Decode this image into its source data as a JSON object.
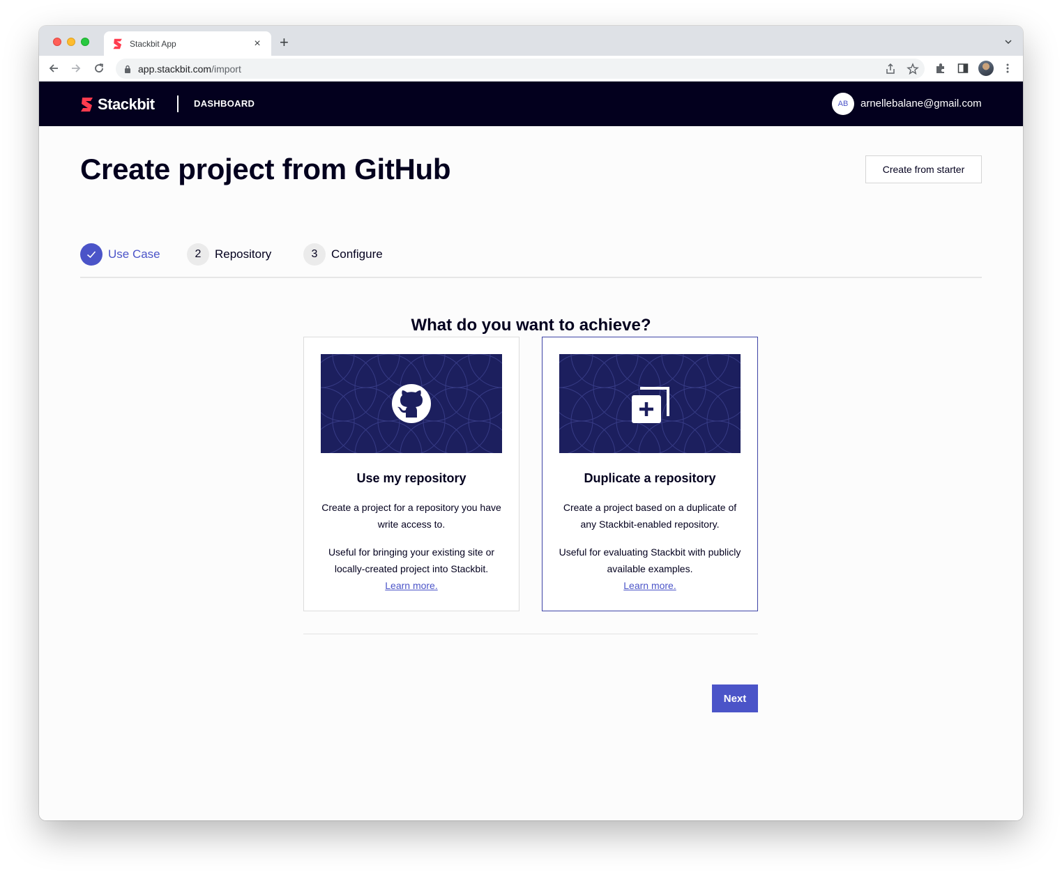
{
  "browser": {
    "tab_title": "Stackbit App",
    "tab_close": "×",
    "new_tab": "+",
    "url_host": "app.stackbit.com",
    "url_path": "/import"
  },
  "header": {
    "logo_text": "Stackbit",
    "nav_dashboard": "DASHBOARD",
    "avatar_initials": "AB",
    "user_email": "arnellebalane@gmail.com"
  },
  "page": {
    "title": "Create project from GitHub",
    "starter_button": "Create from starter"
  },
  "steps": [
    {
      "number": "",
      "label": "Use Case",
      "state": "done"
    },
    {
      "number": "2",
      "label": "Repository",
      "state": "pending"
    },
    {
      "number": "3",
      "label": "Configure",
      "state": "pending"
    }
  ],
  "question": "What do you want to achieve?",
  "cards": [
    {
      "title": "Use my repository",
      "description": "Create a project for a repository you have write access to.",
      "useful": "Useful for bringing your existing site or locally-created project into Stackbit.",
      "link": "Learn more.",
      "icon": "github-icon",
      "selected": false
    },
    {
      "title": "Duplicate a repository",
      "description": "Create a project based on a duplicate of any Stackbit-enabled repository.",
      "useful": "Useful for evaluating Stackbit with publicly available examples.",
      "link": "Learn more.",
      "icon": "duplicate-icon",
      "selected": true
    }
  ],
  "next_button": "Next",
  "colors": {
    "brand_red": "#ff3b4e",
    "accent": "#4b54c8",
    "header_bg": "#03001e",
    "card_art_bg": "#1c1f5e"
  }
}
